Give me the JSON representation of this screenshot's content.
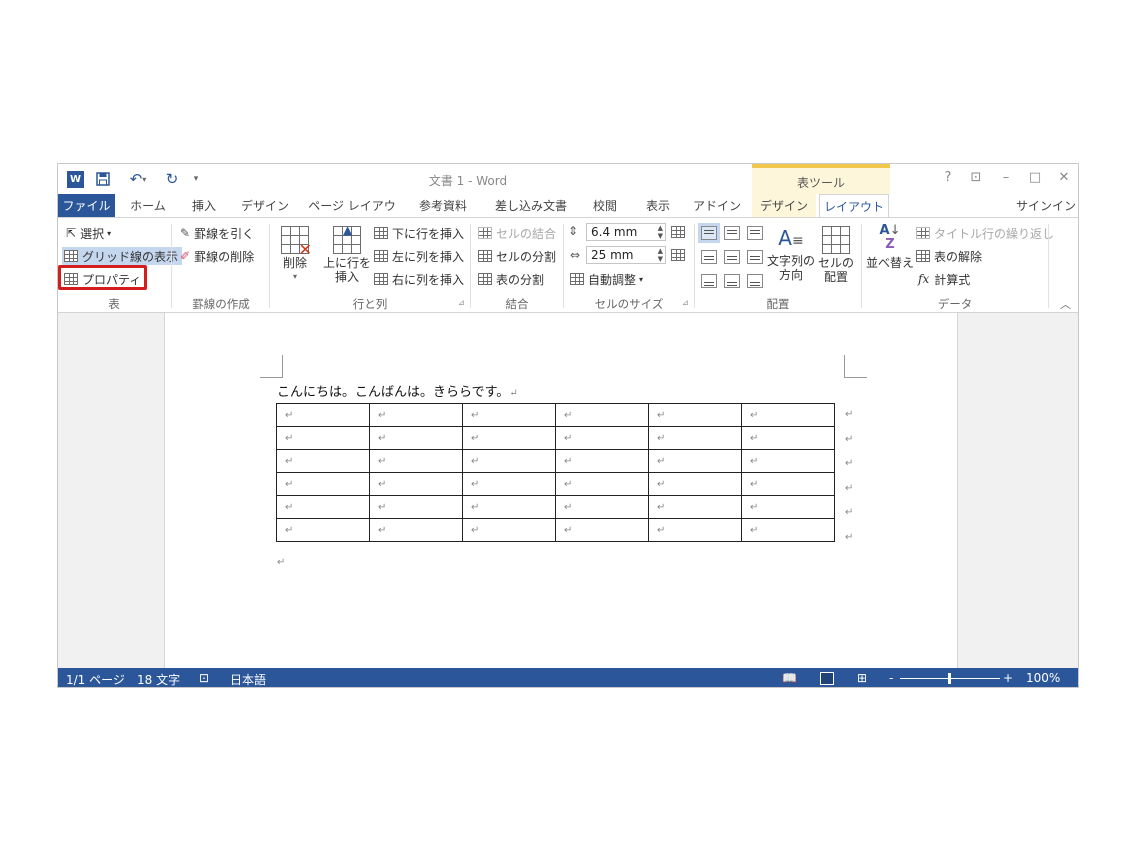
{
  "titlebar": {
    "title": "文書 1 - Word",
    "tool_tab": "表ツール",
    "buttons": [
      "?",
      "⊡",
      "–",
      "□",
      "✕"
    ]
  },
  "tabs": {
    "file": "ファイル",
    "items": [
      "ホーム",
      "挿入",
      "デザイン",
      "ページ レイアウト",
      "参考資料",
      "差し込み文書",
      "校閲",
      "表示",
      "アドイン",
      "デザイン",
      "レイアウト"
    ],
    "signin": "サインイン"
  },
  "ribbon": {
    "table_group": {
      "select": "選択",
      "gridlines": "グリッド線の表示",
      "properties": "プロパティ",
      "label": "表"
    },
    "draw_group": {
      "draw": "罫線を引く",
      "erase": "罫線の削除",
      "label": "罫線の作成"
    },
    "rows_cols": {
      "delete": "削除",
      "insert_above_1": "上に行を",
      "insert_above_2": "挿入",
      "insert_below": "下に行を挿入",
      "insert_left": "左に列を挿入",
      "insert_right": "右に列を挿入",
      "label": "行と列"
    },
    "merge": {
      "merge_cells": "セルの結合",
      "split_cells": "セルの分割",
      "split_table": "表の分割",
      "label": "結合"
    },
    "cell_size": {
      "height": "6.4 mm",
      "width": "25 mm",
      "autofit": "自動調整",
      "label": "セルのサイズ"
    },
    "alignment": {
      "direction_1": "文字列の",
      "direction_2": "方向",
      "margins_1": "セルの",
      "margins_2": "配置",
      "label": "配置"
    },
    "data": {
      "sort": "並べ替え",
      "repeat_header": "タイトル行の繰り返し",
      "convert": "表の解除",
      "formula": "計算式",
      "label": "データ"
    }
  },
  "document": {
    "paragraph": "こんにちは。こんばんは。きららです。",
    "table": {
      "rows": 6,
      "cols": 6,
      "cell_mark": "↵"
    }
  },
  "statusbar": {
    "page": "1/1 ページ",
    "words": "18 文字",
    "language": "日本語",
    "zoom": "100%",
    "zoom_minus": "-",
    "zoom_plus": "+"
  },
  "colors": {
    "accent": "#2b579a",
    "tool_tab": "#fdf6da",
    "highlight": "#d41d1d"
  }
}
